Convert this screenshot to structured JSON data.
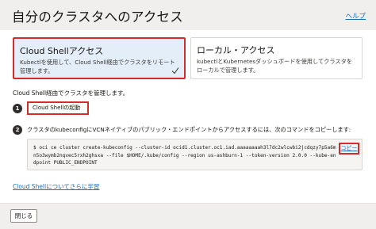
{
  "header": {
    "title": "自分のクラスタへのアクセス",
    "help_label": "ヘルプ"
  },
  "cards": {
    "cloud_shell": {
      "title": "Cloud Shellアクセス",
      "description": "Kubectlを使用して、Cloud Shell経由でクラスタをリモート管理します。",
      "selected": true
    },
    "local": {
      "title": "ローカル・アクセス",
      "description": "kubectlとKubernetesダッシュボードを使用してクラスタをローカルで管理します。",
      "selected": false
    }
  },
  "intro_text": "Cloud Shell経由でクラスタを管理します。",
  "steps": {
    "step1": {
      "number": "1",
      "button_label": "Cloud Shellの起動"
    },
    "step2": {
      "number": "2",
      "text": "クラスタのkubeconfigにVCNネイティブのパブリック・エンドポイントからアクセスするには、次のコマンドをコピーします:",
      "command": "$ oci ce cluster create-kubeconfig --cluster-id ocid1.cluster.oc1.iad.aaaaaaaah3l7dc2wlcwbi2jcdqzy7p5a6mn5o3wymb2nqvec5rxh2ghsxa --file $HOME/.kube/config --region us-ashburn-1 --token-version 2.0.0  --kube-endpoint PUBLIC_ENDPOINT",
      "copy_label": "コピー"
    }
  },
  "learn_more_label": "Cloud Shellについてさらに学習",
  "footer": {
    "close_label": "閉じる"
  },
  "colors": {
    "highlight": "#d52b2b",
    "link": "#1a6eb8",
    "selected_card_bg": "#e4eef8",
    "header_bg": "#f1efed"
  }
}
